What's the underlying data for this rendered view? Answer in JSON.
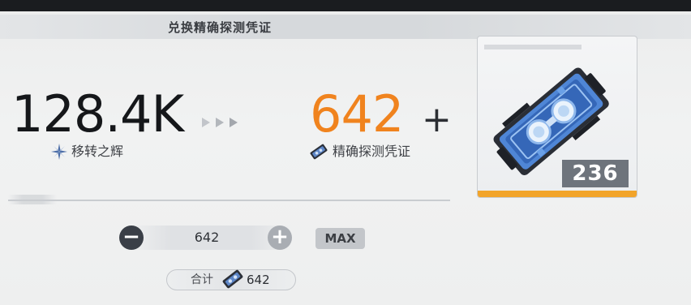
{
  "dialog": {
    "title": "兑换精确探测凭证"
  },
  "exchange": {
    "source_amount": "128.4K",
    "source_name": "移转之辉",
    "target_amount": "642",
    "target_name": "精确探测凭证",
    "plus_symbol": "+"
  },
  "quantity": {
    "value": "642",
    "decrease_label": "−",
    "increase_label": "+",
    "max_label": "MAX"
  },
  "total": {
    "label": "合计",
    "value": "642"
  },
  "item_card": {
    "count": "236",
    "icon": "detection-voucher-icon"
  },
  "colors": {
    "accent_orange": "#f0831e",
    "rarity_bar": "#f2a42a",
    "dark_text": "#15171a"
  }
}
